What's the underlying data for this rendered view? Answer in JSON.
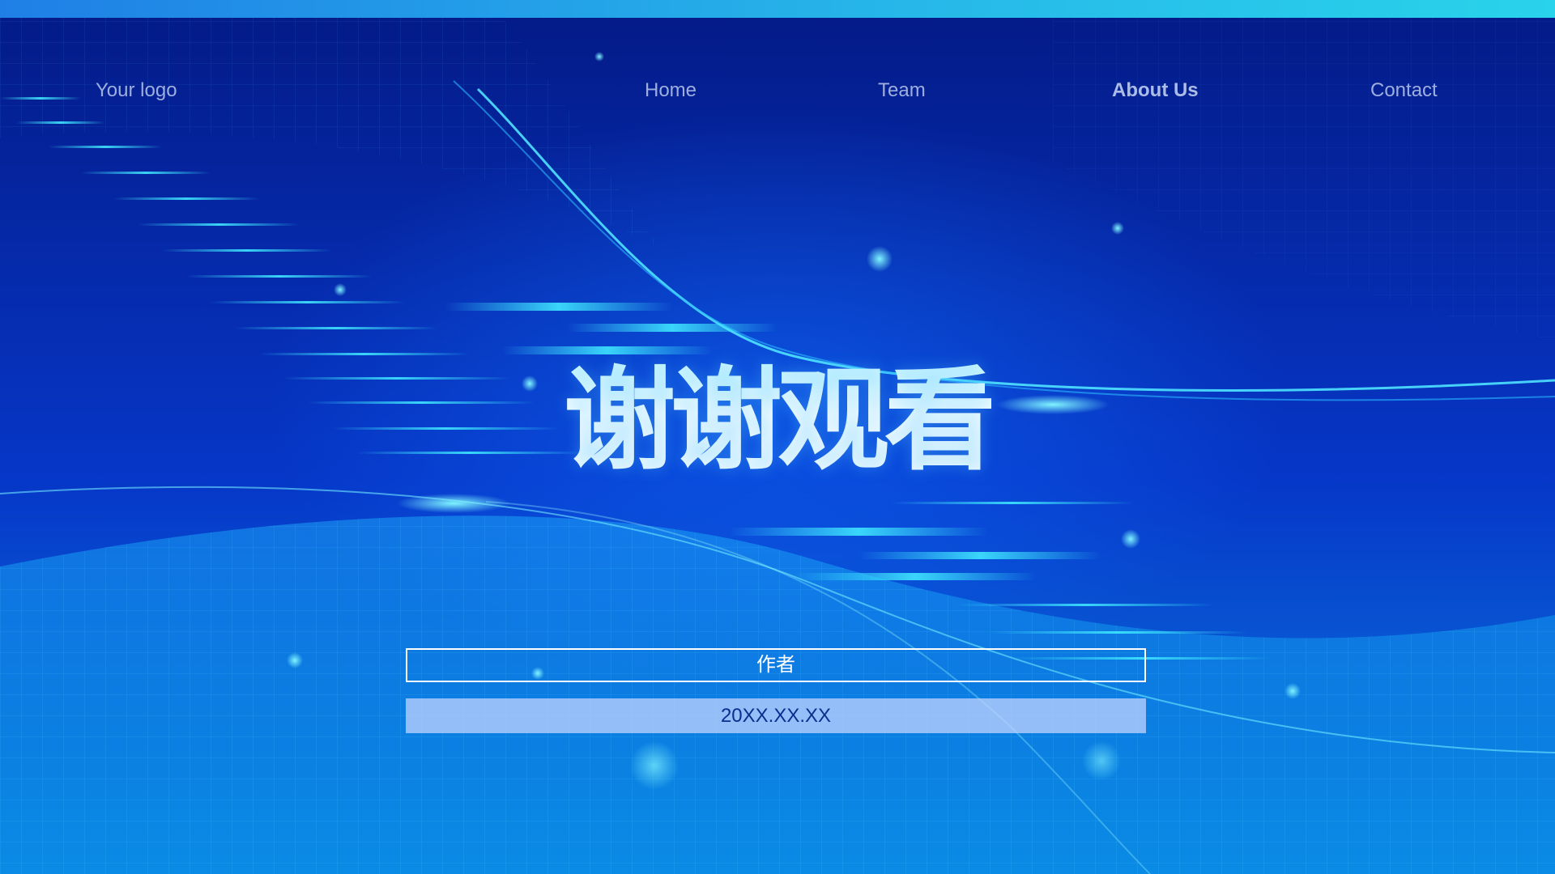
{
  "nav": {
    "logo": "Your logo",
    "items": [
      {
        "label": "Home"
      },
      {
        "label": "Team"
      },
      {
        "label": "About Us"
      },
      {
        "label": "Contact"
      }
    ]
  },
  "hero": {
    "title": "谢谢观看",
    "author": "作者",
    "date": "20XX.XX.XX"
  },
  "colors": {
    "background_dark": "#041a86",
    "background_mid": "#0637c8",
    "accent_cyan": "#29d3ea",
    "title_text": "#ffffff"
  }
}
